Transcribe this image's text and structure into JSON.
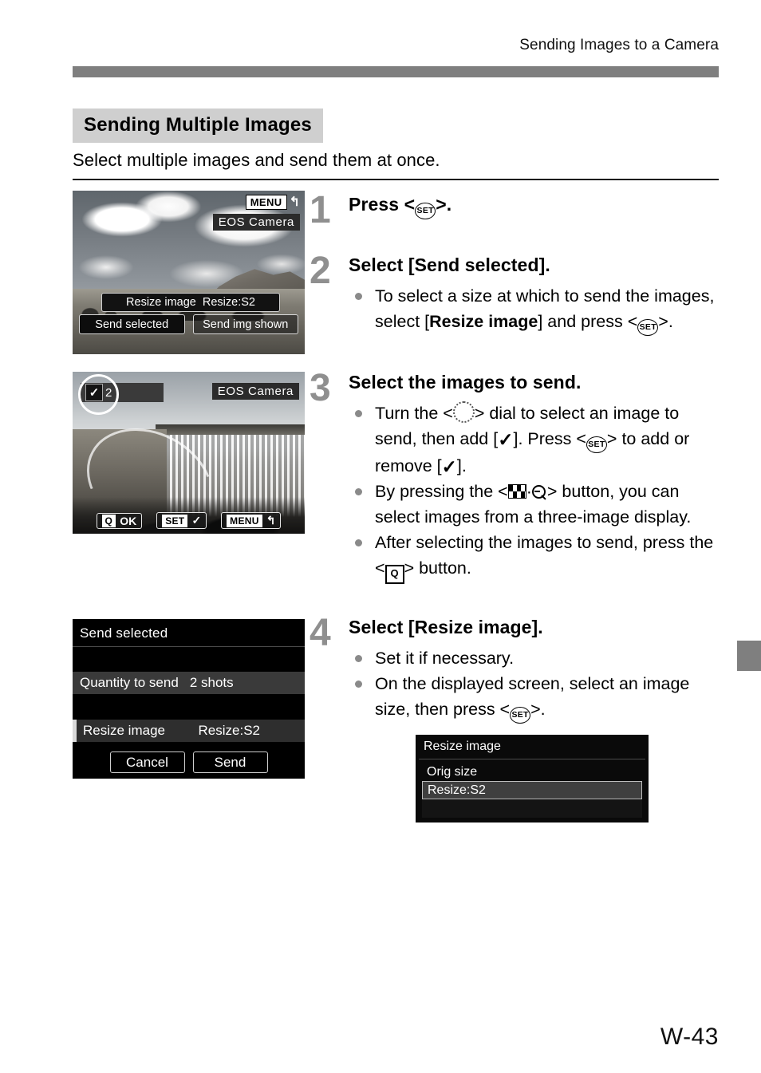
{
  "header": {
    "running_head": "Sending Images to a Camera"
  },
  "section": {
    "heading": "Sending Multiple Images",
    "lead": "Select multiple images and send them at once."
  },
  "steps": [
    {
      "number": "1",
      "title_pre": "Press <",
      "title_icon": "SET",
      "title_post": ">.",
      "bullets": []
    },
    {
      "number": "2",
      "title": "Select [Send selected].",
      "bullets": [
        {
          "parts": [
            {
              "t": "To select a size at which to send the images, select ["
            },
            {
              "t": "Resize image",
              "bold": true
            },
            {
              "t": "] and press <"
            },
            {
              "icon": "SET"
            },
            {
              "t": ">."
            }
          ]
        }
      ]
    },
    {
      "number": "3",
      "title": "Select the images to send.",
      "bullets": [
        {
          "parts": [
            {
              "t": "Turn the <"
            },
            {
              "icon": "dial"
            },
            {
              "t": "> dial to select an image to send, then add ["
            },
            {
              "icon": "check"
            },
            {
              "t": "]. Press <"
            },
            {
              "icon": "SET"
            },
            {
              "t": "> to add or remove ["
            },
            {
              "icon": "check"
            },
            {
              "t": "]."
            }
          ]
        },
        {
          "parts": [
            {
              "t": "By pressing the <"
            },
            {
              "icon": "index-magnify"
            },
            {
              "t": "> button, you can select images from a three-image display."
            }
          ]
        },
        {
          "parts": [
            {
              "t": "After selecting the images to send, press the <"
            },
            {
              "icon": "Q"
            },
            {
              "t": "> button."
            }
          ]
        }
      ]
    },
    {
      "number": "4",
      "title": "Select [Resize image].",
      "bullets": [
        {
          "parts": [
            {
              "t": "Set it if necessary."
            }
          ]
        },
        {
          "parts": [
            {
              "t": "On the displayed screen, select an image size, then press <"
            },
            {
              "icon": "SET"
            },
            {
              "t": ">."
            }
          ]
        }
      ]
    }
  ],
  "screens": {
    "screen1": {
      "menu_label": "MENU",
      "return_glyph": "↰",
      "device": "EOS Camera",
      "resize_row_key": "Resize image",
      "resize_row_value": "Resize:S2",
      "button_selected": "Send selected",
      "button_other": "Send img shown"
    },
    "screen2": {
      "check_glyph": "✓",
      "count_label": "2",
      "device": "EOS Camera",
      "bottom": [
        {
          "box": "Q",
          "label": "OK"
        },
        {
          "box": "SET",
          "label": "✓"
        },
        {
          "box": "MENU",
          "label": "↰"
        }
      ]
    },
    "screen3": {
      "title": "Send selected",
      "quantity_key": "Quantity to send",
      "quantity_value": "2 shots",
      "resize_key": "Resize image",
      "resize_value": "Resize:S2",
      "cancel": "Cancel",
      "send": "Send"
    },
    "screen4": {
      "title": "Resize image",
      "option_orig": "Orig size",
      "option_resize": "Resize:S2"
    }
  },
  "footer": {
    "folio": "W-43"
  },
  "colors": {
    "rule_gray": "#7f7f7f",
    "heading_bg": "#cfcfcf",
    "step_number": "#8f8f8f",
    "bullet_dot": "#8a8a8a"
  }
}
